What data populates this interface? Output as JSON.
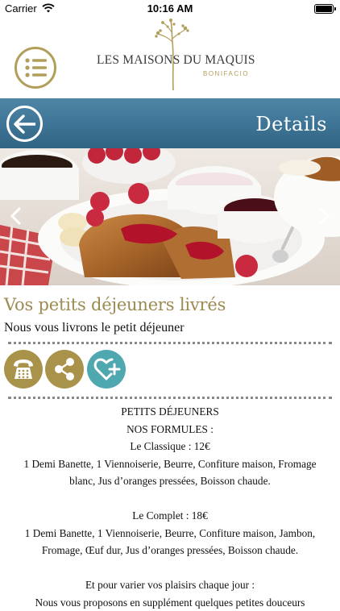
{
  "status": {
    "carrier": "Carrier",
    "time": "10:16 AM"
  },
  "header": {
    "logo_title": "LES MAISONS DU MAQUIS",
    "logo_sub": "BONIFACIO"
  },
  "details_bar": {
    "title": "Details"
  },
  "content": {
    "title": "Vos petits déjeuners livrés",
    "subtitle": "Nous vous livrons le petit déjeuner",
    "lines": [
      "PETITS DÉJEUNERS",
      "NOS FORMULES :",
      "Le Classique : 12€",
      "1 Demi Banette, 1 Viennoiserie, Beurre, Confiture maison, Fromage",
      "blanc, Jus d’oranges pressées, Boisson chaude.",
      "",
      "Le Complet : 18€",
      "1 Demi Banette, 1 Viennoiserie, Beurre, Confiture maison, Jambon,",
      "Fromage, Œuf dur, Jus d’oranges pressées, Boisson chaude.",
      "",
      "Et pour varier vos plaisirs chaque jour :",
      "Nous vous proposons en supplément quelques petites douceurs"
    ]
  },
  "colors": {
    "gold": "#a99249",
    "blue_bar": "#3d7395",
    "teal": "#4fa7b0"
  },
  "icons": [
    "menu-icon",
    "back-arrow-icon",
    "chevron-left-icon",
    "chevron-right-icon",
    "phone-icon",
    "share-icon",
    "heart-plus-icon",
    "wifi-icon",
    "battery-icon"
  ]
}
